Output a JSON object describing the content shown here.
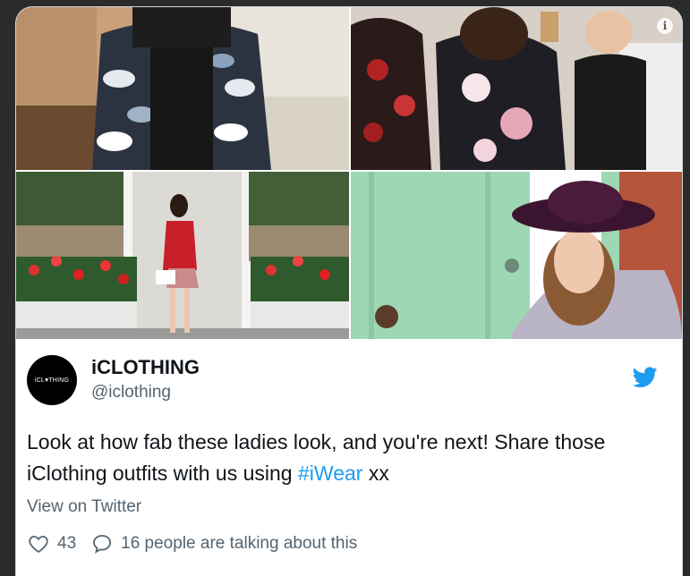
{
  "tweet": {
    "name": "iCLOTHING",
    "handle": "@iclothing",
    "avatar_text": "iCL♥THING",
    "text_main": "Look at how fab these ladies look, and you're next! Share those iClothing outfits with us using ",
    "hashtag": "#iWear",
    "text_end": " xx",
    "view_link": "View on Twitter",
    "likes": "43",
    "talking": "16 people are talking about this"
  },
  "icons": {
    "info": "i",
    "bird": "twitter-bird-icon",
    "heart": "heart-icon",
    "reply": "reply-icon"
  },
  "colors": {
    "accent": "#1d9bf0",
    "text": "#0f1419",
    "muted": "#536471"
  }
}
